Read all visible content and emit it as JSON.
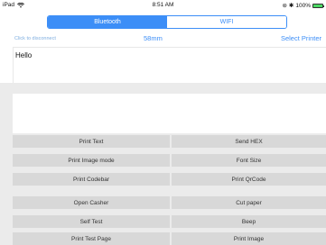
{
  "status_bar": {
    "device": "iPad",
    "time": "8:51 AM",
    "battery": "100%",
    "battery_level": 1.0
  },
  "tabs": [
    {
      "label": "Bluetooth",
      "active": true
    },
    {
      "label": "WIFI",
      "active": false
    }
  ],
  "info": {
    "disconnect": "Click to disconnect",
    "paper_size": "58mm",
    "select_printer": "Select Printer"
  },
  "input": {
    "value": "Hello"
  },
  "buttons": {
    "print_text": "Print Text",
    "send_hex": "Send HEX",
    "print_image_mode": "Print Image mode",
    "font_size": "Font Size",
    "print_codebar": "Print Codebar",
    "print_qrcode": "Print QrCode",
    "open_casher": "Open Casher",
    "cut_paper": "Cut paper",
    "self_test": "Self Test",
    "beep": "Beep",
    "print_test_page": "Print Test Page",
    "print_image": "Print Image"
  },
  "colors": {
    "accent": "#3c8ef7",
    "button_bg": "#d8d8d8",
    "grey_bg": "#ebebeb",
    "battery": "#4cd964"
  }
}
